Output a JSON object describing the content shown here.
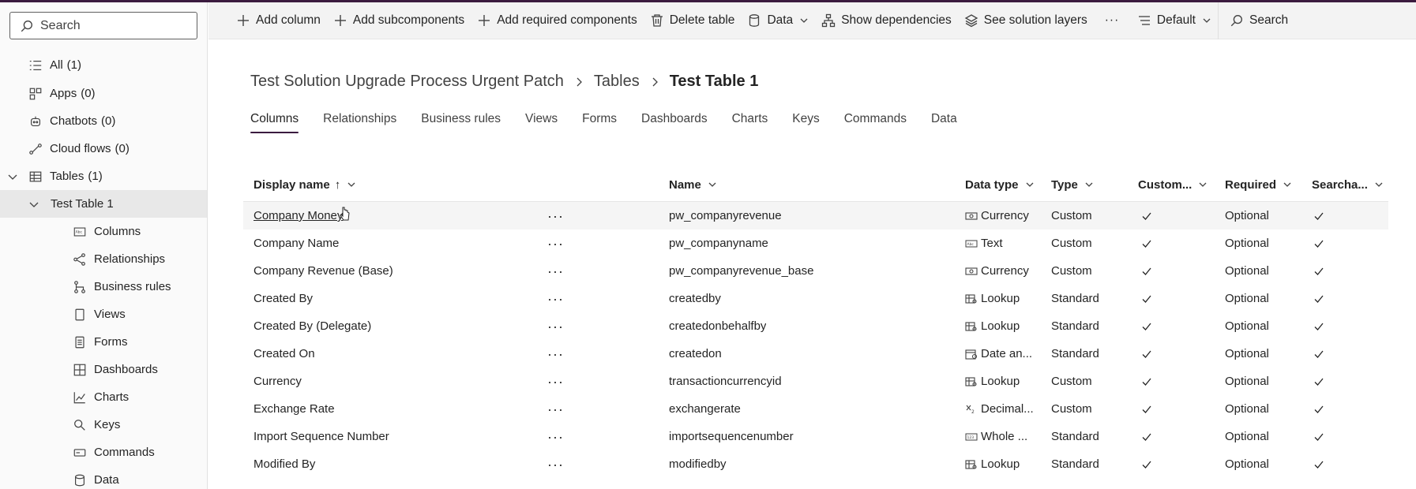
{
  "sidebar": {
    "search_placeholder": "Search",
    "items": [
      {
        "label": "All",
        "count": "(1)"
      },
      {
        "label": "Apps",
        "count": "(0)"
      },
      {
        "label": "Chatbots",
        "count": "(0)"
      },
      {
        "label": "Cloud flows",
        "count": "(0)"
      },
      {
        "label": "Tables",
        "count": "(1)"
      },
      {
        "label": "Test Table 1"
      },
      {
        "label": "Columns"
      },
      {
        "label": "Relationships"
      },
      {
        "label": "Business rules"
      },
      {
        "label": "Views"
      },
      {
        "label": "Forms"
      },
      {
        "label": "Dashboards"
      },
      {
        "label": "Charts"
      },
      {
        "label": "Keys"
      },
      {
        "label": "Commands"
      },
      {
        "label": "Data"
      }
    ]
  },
  "toolbar": {
    "add_column": "Add column",
    "add_subcomponents": "Add subcomponents",
    "add_required": "Add required components",
    "delete_table": "Delete table",
    "data": "Data",
    "show_dependencies": "Show dependencies",
    "see_solution_layers": "See solution layers",
    "more": "···",
    "view_default": "Default",
    "search": "Search"
  },
  "breadcrumb": {
    "solution": "Test Solution Upgrade Process Urgent Patch",
    "tables": "Tables",
    "current": "Test Table 1"
  },
  "tabs": [
    "Columns",
    "Relationships",
    "Business rules",
    "Views",
    "Forms",
    "Dashboards",
    "Charts",
    "Keys",
    "Commands",
    "Data"
  ],
  "table": {
    "headers": {
      "display_name": "Display name",
      "sort_arrow": "↑",
      "name": "Name",
      "data_type": "Data type",
      "type": "Type",
      "customizable": "Custom...",
      "required": "Required",
      "searchable": "Searcha..."
    },
    "more_label": "···",
    "rows": [
      {
        "display": "Company Money",
        "name": "pw_companyrevenue",
        "dtype": "Currency",
        "dicon": "currency-icon",
        "type": "Custom",
        "required": "Optional"
      },
      {
        "display": "Company Name",
        "name": "pw_companyname",
        "dtype": "Text",
        "dicon": "text-icon",
        "type": "Custom",
        "required": "Optional"
      },
      {
        "display": "Company Revenue (Base)",
        "name": "pw_companyrevenue_base",
        "dtype": "Currency",
        "dicon": "currency-icon",
        "type": "Custom",
        "required": "Optional"
      },
      {
        "display": "Created By",
        "name": "createdby",
        "dtype": "Lookup",
        "dicon": "lookup-icon",
        "type": "Standard",
        "required": "Optional"
      },
      {
        "display": "Created By (Delegate)",
        "name": "createdonbehalfby",
        "dtype": "Lookup",
        "dicon": "lookup-icon",
        "type": "Standard",
        "required": "Optional"
      },
      {
        "display": "Created On",
        "name": "createdon",
        "dtype": "Date an...",
        "dicon": "calendar-icon",
        "type": "Standard",
        "required": "Optional"
      },
      {
        "display": "Currency",
        "name": "transactioncurrencyid",
        "dtype": "Lookup",
        "dicon": "lookup-icon",
        "type": "Custom",
        "required": "Optional"
      },
      {
        "display": "Exchange Rate",
        "name": "exchangerate",
        "dtype": "Decimal...",
        "dicon": "decimal-icon",
        "type": "Custom",
        "required": "Optional"
      },
      {
        "display": "Import Sequence Number",
        "name": "importsequencenumber",
        "dtype": "Whole ...",
        "dicon": "number-icon",
        "type": "Standard",
        "required": "Optional"
      },
      {
        "display": "Modified By",
        "name": "modifiedby",
        "dtype": "Lookup",
        "dicon": "lookup-icon",
        "type": "Standard",
        "required": "Optional"
      }
    ]
  }
}
